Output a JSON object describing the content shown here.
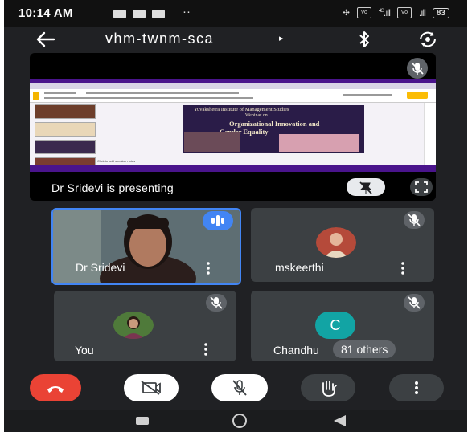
{
  "status_bar": {
    "time": "10:14 AM",
    "battery": "83",
    "signal_4g": "4G"
  },
  "app_bar": {
    "meeting_code": "vhm-twnm-sca",
    "arrow": "▸"
  },
  "presentation": {
    "label": "Dr Sridevi is presenting",
    "slide_header": "Yuvakshetra Institute of Management Studies",
    "slide_line1": "Webinar",
    "slide_line2": "on",
    "slide_line3": "Organizational Innovation and",
    "slide_line4": "Gender Equality",
    "notes_hint": "Click to add speaker notes"
  },
  "participants": [
    {
      "name": "Dr Sridevi",
      "speaking": true
    },
    {
      "name": "mskeerthi",
      "muted": true
    },
    {
      "name": "You",
      "muted": true
    },
    {
      "name": "Chandhu",
      "initial": "C",
      "others": "81 others",
      "muted": true
    }
  ],
  "colors": {
    "end_call": "#ea4335",
    "speaking_border": "#4285f4",
    "avatar_c": "#12a4a4"
  }
}
